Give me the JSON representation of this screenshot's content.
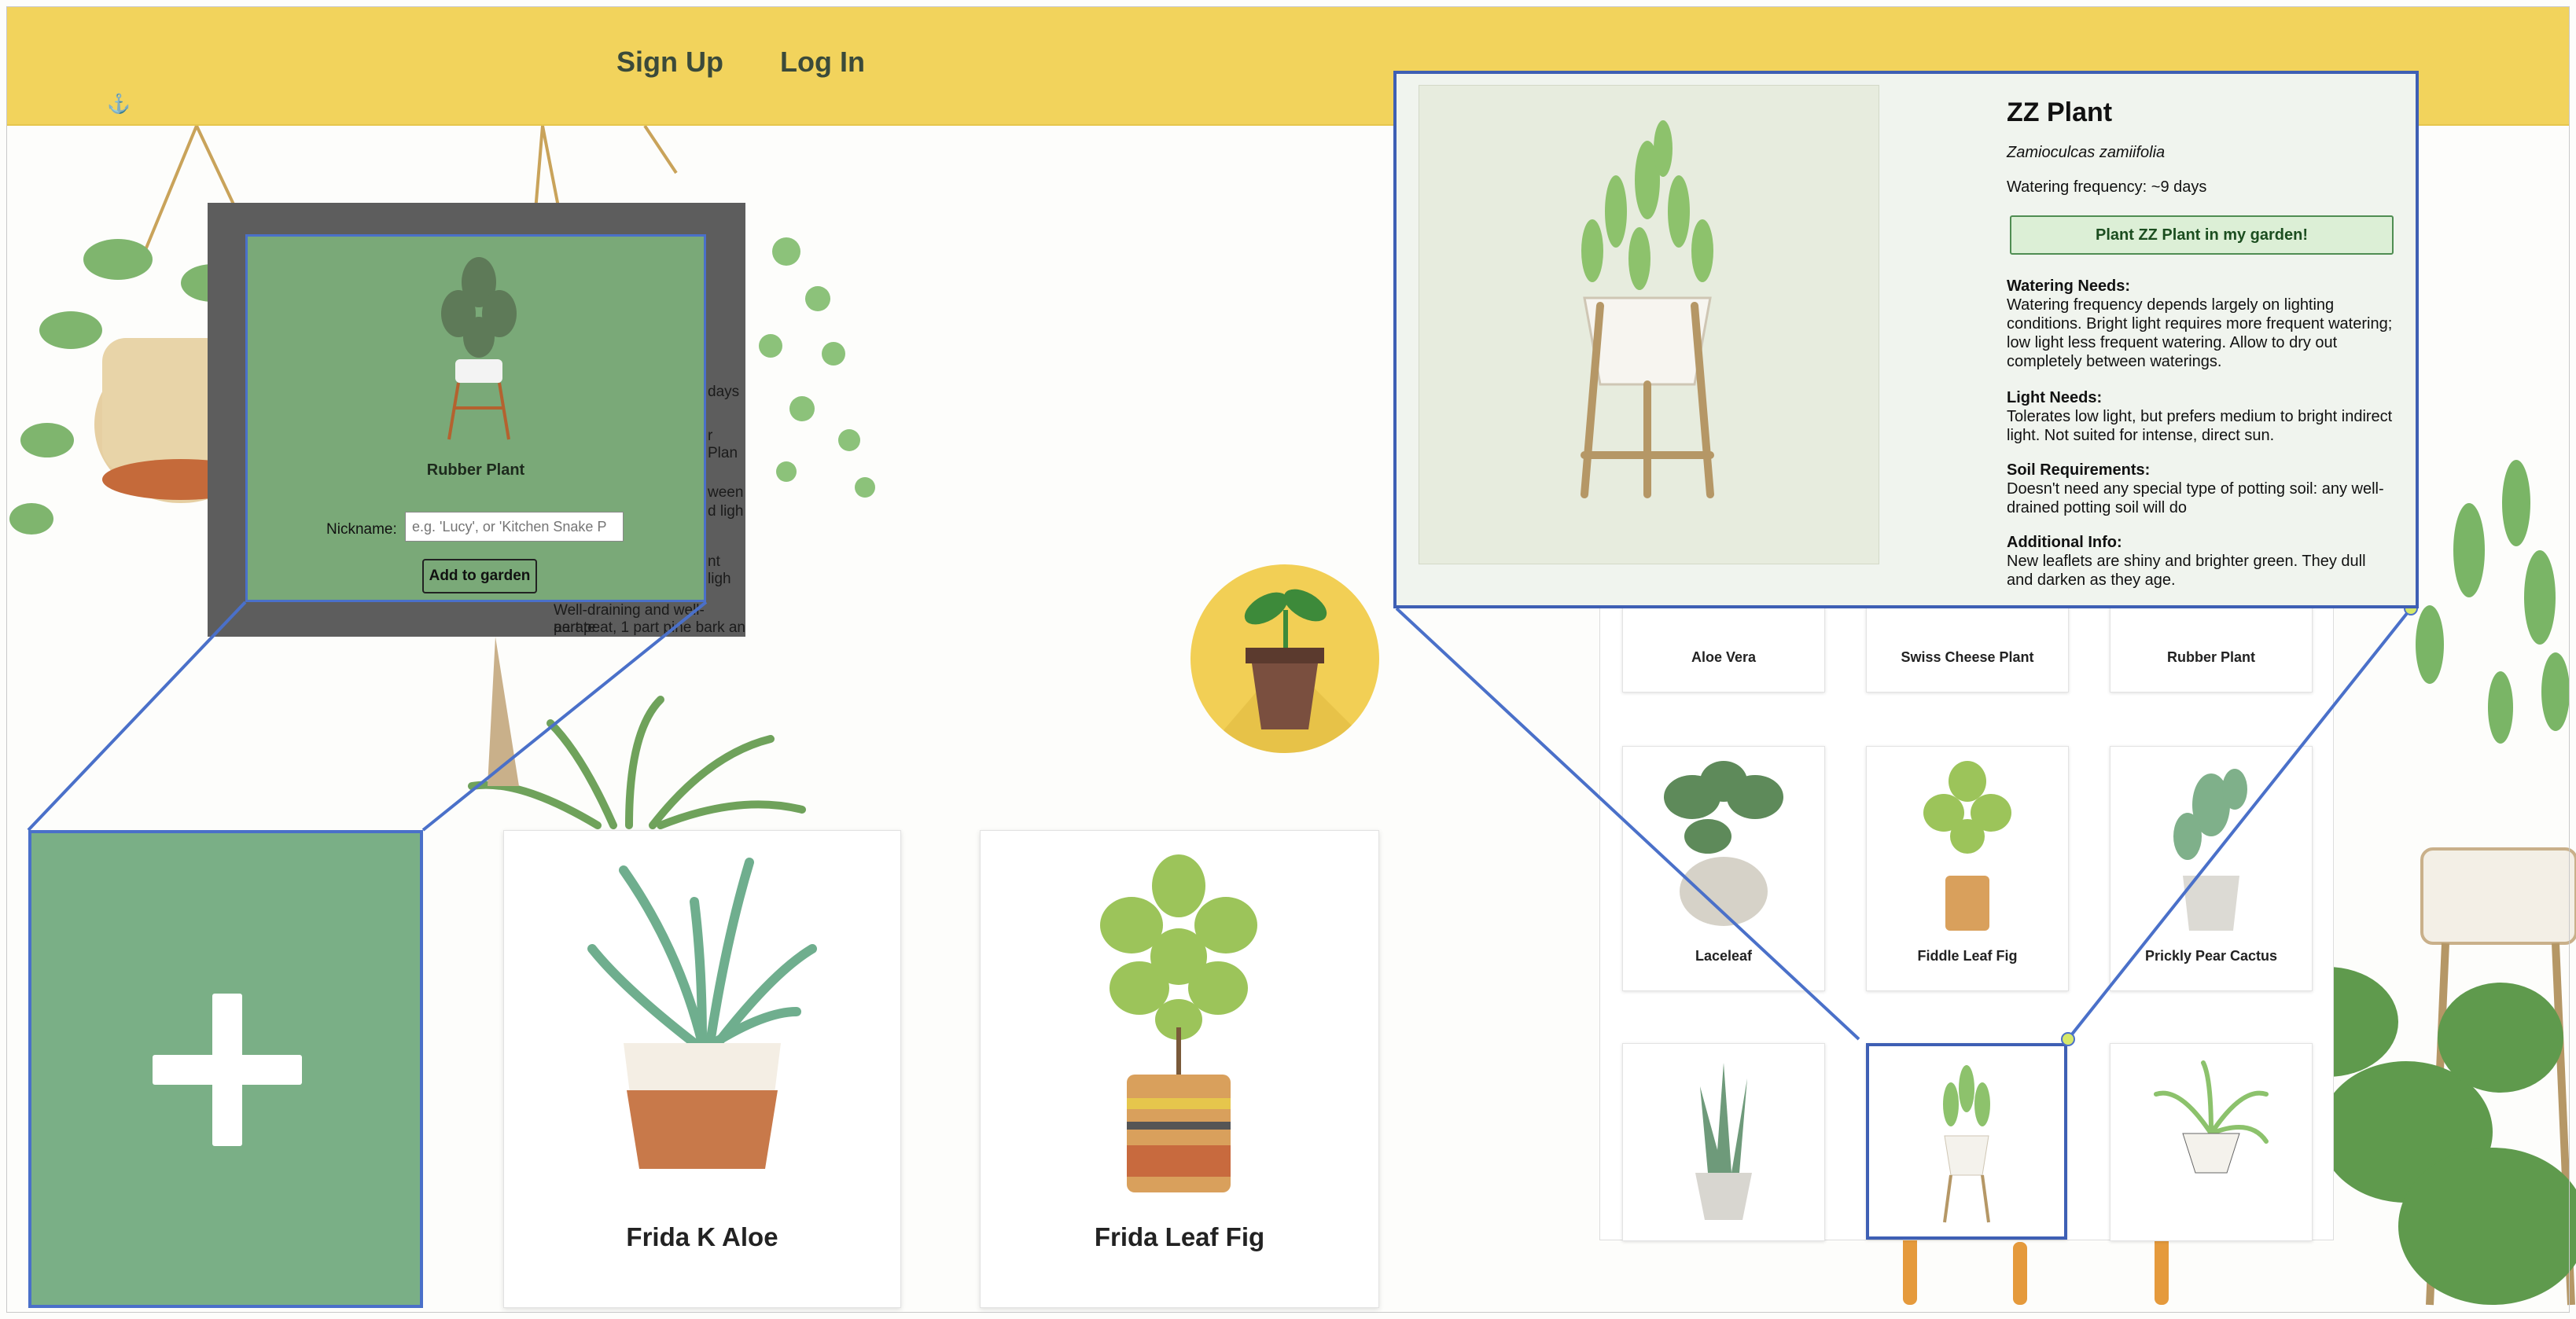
{
  "header": {
    "signup_label": "Sign Up",
    "login_label": "Log In",
    "anchor_icon": "anchor-icon",
    "background_color": "#f2d35c"
  },
  "modal": {
    "plant_name": "Rubber Plant",
    "nickname_label": "Nickname:",
    "nickname_placeholder": "e.g. 'Lucy', or 'Kitchen Snake P",
    "add_button": "Add to garden",
    "ghost_text": [
      "days",
      "r Plan",
      "ween",
      "d ligh",
      "nt ligh",
      "Well-draining and well-aerate",
      "part peat, 1 part pine bark an"
    ],
    "background_color": "#7aa978"
  },
  "garden_cards": [
    {
      "name": "Frida K Aloe"
    },
    {
      "name": "Frida Leaf Fig"
    }
  ],
  "add_card": {
    "icon": "plus-icon",
    "color": "#7aaf86"
  },
  "logo": {
    "icon": "plant-pot-logo",
    "color": "#f2cf55"
  },
  "plant_grid": [
    {
      "name": "Aloe Vera"
    },
    {
      "name": "Swiss Cheese Plant"
    },
    {
      "name": "Rubber Plant"
    },
    {
      "name": "Laceleaf"
    },
    {
      "name": "Fiddle Leaf Fig"
    },
    {
      "name": "Prickly Pear Cactus"
    },
    {
      "name": ""
    },
    {
      "name": ""
    },
    {
      "name": ""
    }
  ],
  "zz_panel": {
    "title": "ZZ Plant",
    "scientific_name": "Zamioculcas zamiifolia",
    "watering_frequency": "Watering frequency: ~9 days",
    "plant_button": "Plant ZZ Plant in my garden!",
    "sections": [
      {
        "heading": "Watering Needs:",
        "text": "Watering frequency depends largely on lighting conditions. Bright light requires more frequent watering; low light less frequent watering. Allow to dry out completely between waterings."
      },
      {
        "heading": "Light Needs:",
        "text": "Tolerates low light, but prefers medium to bright indirect light. Not suited for intense, direct sun."
      },
      {
        "heading": "Soil Requirements:",
        "text": "Doesn't need any special type of potting soil: any well-drained potting soil will do"
      },
      {
        "heading": "Additional Info:",
        "text": "New leaflets are shiny and brighter green. They dull and darken as they age."
      }
    ]
  },
  "colors": {
    "callout_line": "#4a70c9",
    "accent_green": "#4f8d52"
  }
}
